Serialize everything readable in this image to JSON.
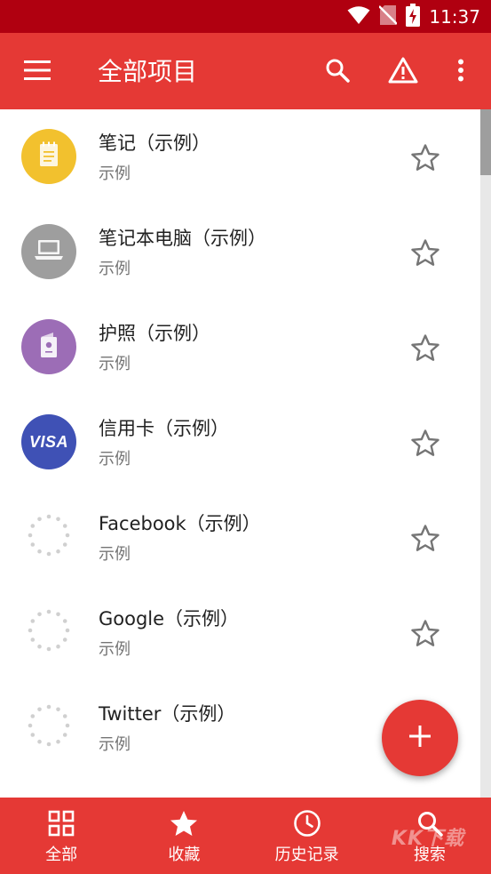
{
  "status_bar": {
    "time": "11:37",
    "icons": [
      "wifi-icon",
      "no-sim-icon",
      "battery-charging-icon"
    ]
  },
  "app_bar": {
    "title": "全部项目",
    "actions": [
      "search-icon",
      "warning-icon",
      "more-vert-icon"
    ]
  },
  "items": [
    {
      "name": "笔记（示例）",
      "subtitle": "示例",
      "icon": "note-icon",
      "color": "#f2c12e"
    },
    {
      "name": "笔记本电脑（示例）",
      "subtitle": "示例",
      "icon": "laptop-icon",
      "color": "#9e9e9e"
    },
    {
      "name": "护照（示例）",
      "subtitle": "示例",
      "icon": "passport-icon",
      "color": "#9c6db6"
    },
    {
      "name": "信用卡（示例）",
      "subtitle": "示例",
      "icon": "visa-icon",
      "icon_text": "VISA",
      "color": "#3f51b5"
    },
    {
      "name": "Facebook（示例）",
      "subtitle": "示例",
      "icon": "loading-spinner-icon"
    },
    {
      "name": "Google（示例）",
      "subtitle": "示例",
      "icon": "loading-spinner-icon"
    },
    {
      "name": "Twitter（示例）",
      "subtitle": "示例",
      "icon": "loading-spinner-icon"
    }
  ],
  "fab": {
    "icon": "plus-icon",
    "label": "+"
  },
  "bottom_nav": [
    {
      "label": "全部",
      "icon": "grid-icon"
    },
    {
      "label": "收藏",
      "icon": "star-icon"
    },
    {
      "label": "历史记录",
      "icon": "clock-icon"
    },
    {
      "label": "搜索",
      "icon": "search-icon"
    }
  ],
  "watermark": "KK下载",
  "colors": {
    "primary": "#e53935",
    "status_bar": "#b00010",
    "text_primary": "#212121",
    "text_secondary": "#757575",
    "star": "#757575"
  }
}
